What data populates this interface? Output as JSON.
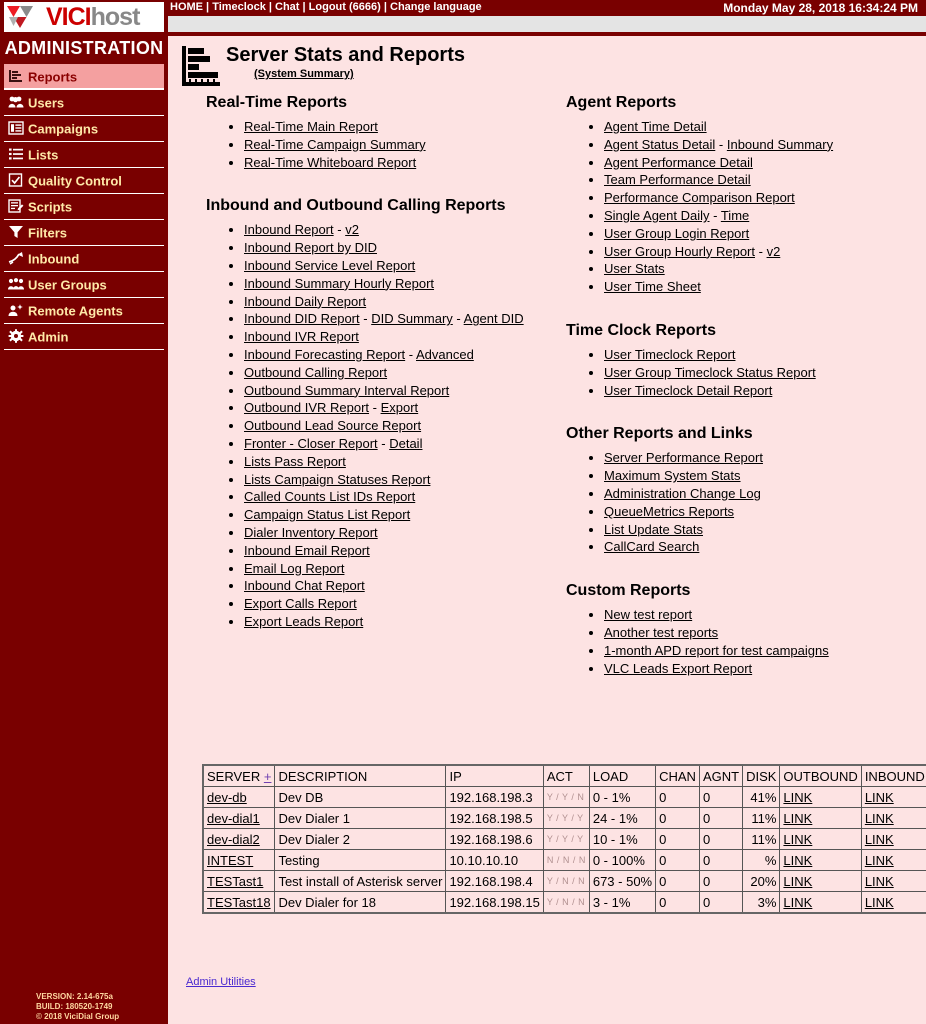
{
  "topnav": {
    "items": [
      "HOME",
      "Timeclock",
      "Chat",
      "Logout (6666)",
      "Change language"
    ],
    "separator": " | ",
    "clock": "Monday May 28, 2018 16:34:24 PM"
  },
  "brand": {
    "logo_vici": "VICI",
    "logo_host": "host",
    "section_title": "ADMINISTRATION",
    "version": "VERSION: 2.14-675a",
    "build": "BUILD: 180520-1749",
    "copyright": "© 2018 ViciDial Group"
  },
  "sidebar": {
    "items": [
      {
        "label": "Reports",
        "icon": "bar-chart-icon",
        "active": true
      },
      {
        "label": "Users",
        "icon": "users-icon",
        "active": false
      },
      {
        "label": "Campaigns",
        "icon": "campaigns-icon",
        "active": false
      },
      {
        "label": "Lists",
        "icon": "list-icon",
        "active": false
      },
      {
        "label": "Quality Control",
        "icon": "checkbox-icon",
        "active": false
      },
      {
        "label": "Scripts",
        "icon": "script-icon",
        "active": false
      },
      {
        "label": "Filters",
        "icon": "funnel-icon",
        "active": false
      },
      {
        "label": "Inbound",
        "icon": "inbound-arrow-icon",
        "active": false
      },
      {
        "label": "User Groups",
        "icon": "user-groups-icon",
        "active": false
      },
      {
        "label": "Remote Agents",
        "icon": "remote-agent-icon",
        "active": false
      },
      {
        "label": "Admin",
        "icon": "gear-icon",
        "active": false
      }
    ]
  },
  "page": {
    "title": "Server Stats and Reports",
    "subtitle": "(System Summary)",
    "icon": "bar-chart-icon"
  },
  "sections": {
    "realtime": {
      "title": "Real-Time Reports",
      "items": [
        {
          "parts": [
            {
              "t": "Real-Time Main Report",
              "link": true
            }
          ]
        },
        {
          "parts": [
            {
              "t": "Real-Time Campaign Summary",
              "link": true
            }
          ]
        },
        {
          "parts": [
            {
              "t": "Real-Time Whiteboard Report",
              "link": true
            }
          ]
        }
      ]
    },
    "calling": {
      "title": "Inbound and Outbound Calling Reports",
      "items": [
        {
          "parts": [
            {
              "t": "Inbound Report",
              "link": true
            },
            {
              "t": " - ",
              "link": false
            },
            {
              "t": "v2",
              "link": true
            }
          ]
        },
        {
          "parts": [
            {
              "t": "Inbound Report by DID",
              "link": true
            }
          ]
        },
        {
          "parts": [
            {
              "t": "Inbound Service Level Report",
              "link": true
            }
          ]
        },
        {
          "parts": [
            {
              "t": "Inbound Summary Hourly Report",
              "link": true
            }
          ]
        },
        {
          "parts": [
            {
              "t": "Inbound Daily Report",
              "link": true
            }
          ]
        },
        {
          "parts": [
            {
              "t": "Inbound DID Report",
              "link": true
            },
            {
              "t": " - ",
              "link": false
            },
            {
              "t": "DID Summary",
              "link": true
            },
            {
              "t": " - ",
              "link": false
            },
            {
              "t": "Agent DID",
              "link": true
            }
          ]
        },
        {
          "parts": [
            {
              "t": "Inbound IVR Report",
              "link": true
            }
          ]
        },
        {
          "parts": [
            {
              "t": "Inbound Forecasting Report",
              "link": true
            },
            {
              "t": " - ",
              "link": false
            },
            {
              "t": "Advanced",
              "link": true
            }
          ]
        },
        {
          "parts": [
            {
              "t": "Outbound Calling Report",
              "link": true
            }
          ]
        },
        {
          "parts": [
            {
              "t": "Outbound Summary Interval Report",
              "link": true
            }
          ]
        },
        {
          "parts": [
            {
              "t": "Outbound IVR Report",
              "link": true
            },
            {
              "t": " - ",
              "link": false
            },
            {
              "t": "Export",
              "link": true
            }
          ]
        },
        {
          "parts": [
            {
              "t": "Outbound Lead Source Report",
              "link": true
            }
          ]
        },
        {
          "parts": [
            {
              "t": "Fronter - Closer Report",
              "link": true
            },
            {
              "t": " - ",
              "link": false
            },
            {
              "t": "Detail",
              "link": true
            }
          ]
        },
        {
          "parts": [
            {
              "t": "Lists Pass Report",
              "link": true
            }
          ]
        },
        {
          "parts": [
            {
              "t": "Lists Campaign Statuses Report",
              "link": true
            }
          ]
        },
        {
          "parts": [
            {
              "t": "Called Counts List IDs Report",
              "link": true
            }
          ]
        },
        {
          "parts": [
            {
              "t": "Campaign Status List Report",
              "link": true
            }
          ]
        },
        {
          "parts": [
            {
              "t": "Dialer Inventory Report",
              "link": true
            }
          ]
        },
        {
          "parts": [
            {
              "t": "Inbound Email Report",
              "link": true
            }
          ]
        },
        {
          "parts": [
            {
              "t": "Email Log Report",
              "link": true
            }
          ]
        },
        {
          "parts": [
            {
              "t": "Inbound Chat Report",
              "link": true
            }
          ]
        },
        {
          "parts": [
            {
              "t": "Export Calls Report",
              "link": true
            }
          ]
        },
        {
          "parts": [
            {
              "t": "Export Leads Report",
              "link": true
            }
          ]
        }
      ]
    },
    "agent": {
      "title": "Agent Reports",
      "items": [
        {
          "parts": [
            {
              "t": "Agent Time Detail",
              "link": true
            }
          ]
        },
        {
          "parts": [
            {
              "t": "Agent Status Detail",
              "link": true
            },
            {
              "t": " - ",
              "link": false
            },
            {
              "t": "Inbound Summary",
              "link": true
            }
          ]
        },
        {
          "parts": [
            {
              "t": "Agent Performance Detail",
              "link": true
            }
          ]
        },
        {
          "parts": [
            {
              "t": "Team Performance Detail",
              "link": true
            }
          ]
        },
        {
          "parts": [
            {
              "t": "Performance Comparison Report",
              "link": true
            }
          ]
        },
        {
          "parts": [
            {
              "t": "Single Agent Daily",
              "link": true
            },
            {
              "t": " - ",
              "link": false
            },
            {
              "t": "Time",
              "link": true
            }
          ]
        },
        {
          "parts": [
            {
              "t": "User Group Login Report",
              "link": true
            }
          ]
        },
        {
          "parts": [
            {
              "t": "User Group Hourly Report",
              "link": true
            },
            {
              "t": " - ",
              "link": false
            },
            {
              "t": "v2",
              "link": true
            }
          ]
        },
        {
          "parts": [
            {
              "t": "User Stats",
              "link": true
            }
          ]
        },
        {
          "parts": [
            {
              "t": "User Time Sheet",
              "link": true
            }
          ]
        }
      ]
    },
    "timeclock": {
      "title": "Time Clock Reports",
      "items": [
        {
          "parts": [
            {
              "t": "User Timeclock Report",
              "link": true
            }
          ]
        },
        {
          "parts": [
            {
              "t": "User Group Timeclock Status Report",
              "link": true
            }
          ]
        },
        {
          "parts": [
            {
              "t": "User Timeclock Detail Report",
              "link": true
            }
          ]
        }
      ]
    },
    "other": {
      "title": "Other Reports and Links",
      "items": [
        {
          "parts": [
            {
              "t": "Server Performance Report",
              "link": true
            }
          ]
        },
        {
          "parts": [
            {
              "t": "Maximum System Stats",
              "link": true
            }
          ]
        },
        {
          "parts": [
            {
              "t": "Administration Change Log",
              "link": true
            }
          ]
        },
        {
          "parts": [
            {
              "t": "QueueMetrics Reports",
              "link": true
            }
          ]
        },
        {
          "parts": [
            {
              "t": "List Update Stats",
              "link": true
            }
          ]
        },
        {
          "parts": [
            {
              "t": "CallCard Search",
              "link": true
            }
          ]
        }
      ]
    },
    "custom": {
      "title": "Custom Reports",
      "items": [
        {
          "parts": [
            {
              "t": "New test report",
              "link": true
            }
          ]
        },
        {
          "parts": [
            {
              "t": "Another test reports",
              "link": true
            }
          ]
        },
        {
          "parts": [
            {
              "t": "1-month APD report for test campaigns",
              "link": true
            }
          ]
        },
        {
          "parts": [
            {
              "t": "VLC Leads Export Report",
              "link": true
            }
          ]
        }
      ]
    }
  },
  "server_table": {
    "sort_marker": "+",
    "columns": [
      "SERVER",
      "DESCRIPTION",
      "IP",
      "ACT",
      "LOAD",
      "CHAN",
      "AGNT",
      "DISK",
      "OUTBOUND",
      "INBOUND"
    ],
    "rows": [
      {
        "server": "dev-db",
        "description": "Dev DB",
        "ip": "192.168.198.3",
        "act": "Y / Y / N",
        "load": "0 - 1%",
        "chan": "0",
        "agnt": "0",
        "disk": "41%",
        "outbound": "LINK",
        "inbound": "LINK"
      },
      {
        "server": "dev-dial1",
        "description": "Dev Dialer 1",
        "ip": "192.168.198.5",
        "act": "Y / Y / Y",
        "load": "24 - 1%",
        "chan": "0",
        "agnt": "0",
        "disk": "11%",
        "outbound": "LINK",
        "inbound": "LINK"
      },
      {
        "server": "dev-dial2",
        "description": "Dev Dialer 2",
        "ip": "192.168.198.6",
        "act": "Y / Y / Y",
        "load": "10 - 1%",
        "chan": "0",
        "agnt": "0",
        "disk": "11%",
        "outbound": "LINK",
        "inbound": "LINK"
      },
      {
        "server": "INTEST",
        "description": "Testing",
        "ip": "10.10.10.10",
        "act": "N / N / N",
        "load": "0 - 100%",
        "chan": "0",
        "agnt": "0",
        "disk": "%",
        "outbound": "LINK",
        "inbound": "LINK"
      },
      {
        "server": "TESTast1",
        "description": "Test install of Asterisk server",
        "ip": "192.168.198.4",
        "act": "Y / N / N",
        "load": "673 - 50%",
        "chan": "0",
        "agnt": "0",
        "disk": "20%",
        "outbound": "LINK",
        "inbound": "LINK"
      },
      {
        "server": "TESTast18",
        "description": "Dev Dialer for 18",
        "ip": "192.168.198.15",
        "act": "Y / N / N",
        "load": "3 - 1%",
        "chan": "0",
        "agnt": "0",
        "disk": "3%",
        "outbound": "LINK",
        "inbound": "LINK"
      }
    ]
  },
  "footer": {
    "admin_utilities": "Admin Utilities"
  },
  "colors": {
    "brand_dark_red": "#790000",
    "panel_pink": "#fde3e3",
    "active_nav": "#f4a0a0",
    "nav_text": "#ffe9a8",
    "gray_bar": "#e4e4e4",
    "link_purple": "#4a2ad0"
  }
}
